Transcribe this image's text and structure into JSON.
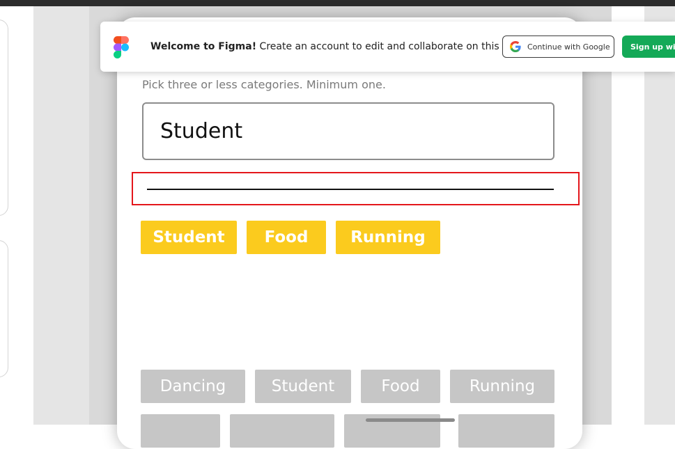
{
  "banner": {
    "welcome_bold": "Welcome to Figma!",
    "welcome_text": " Create an account to edit and collaborate on this file.",
    "google_label": "Continue with Google",
    "signup_label": "Sign up with"
  },
  "form": {
    "subtitle": "Pick three or less categories. Minimum one.",
    "input_value": "Student"
  },
  "selected_chips": [
    "Student",
    "Food",
    "Running"
  ],
  "available_chips_row1": [
    "Dancing",
    "Student",
    "Food",
    "Running"
  ],
  "colors": {
    "selected_chip": "#fbcb1e",
    "available_chip": "#c6c6c6",
    "focus_outline": "#e4161b",
    "signup_button": "#14a957"
  },
  "icons": [
    "figma-logo-icon",
    "google-icon"
  ]
}
